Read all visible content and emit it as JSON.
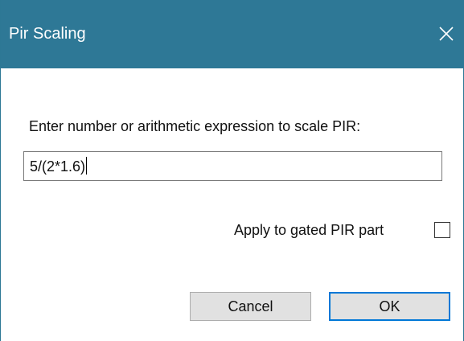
{
  "window": {
    "title": "Pir Scaling",
    "close_icon": "close-icon"
  },
  "dialog": {
    "prompt": "Enter number or arithmetic expression to scale PIR:",
    "expression_value": "5/(2*1.6)",
    "apply_label": "Apply to gated PIR part",
    "apply_checked": false,
    "cancel_label": "Cancel",
    "ok_label": "OK"
  },
  "colors": {
    "titlebar": "#2e7896",
    "default_button_border": "#0078d7"
  }
}
